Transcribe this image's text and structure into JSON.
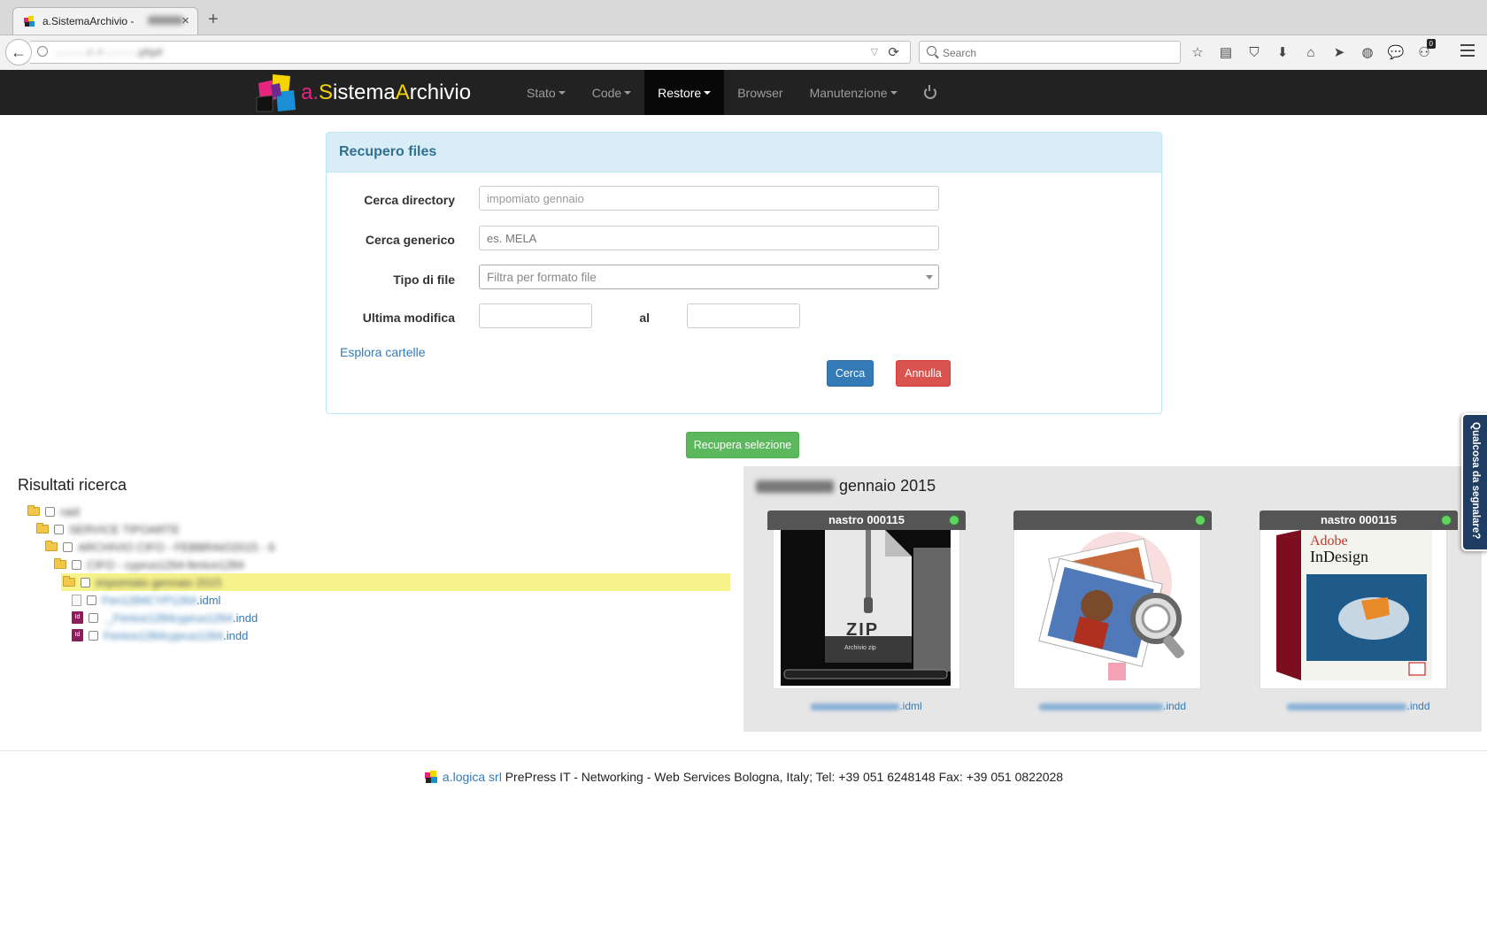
{
  "browser": {
    "tab_title": "a.SistemaArchivio -",
    "tab_close": "×",
    "new_tab": "+",
    "address": "·.··.··.··/··/··.·······.php#",
    "search_placeholder": "Search",
    "addon_badge": "0"
  },
  "app": {
    "brand_a": "a.",
    "brand_s": "S",
    "brand_istema": "istema",
    "brand_A": "A",
    "brand_rchivio": "rchivio",
    "menu": [
      {
        "label": "Stato"
      },
      {
        "label": "Code"
      },
      {
        "label": "Restore"
      },
      {
        "label": "Browser"
      },
      {
        "label": "Manutenzione"
      }
    ]
  },
  "search_panel": {
    "title": "Recupero files",
    "label_directory": "Cerca directory",
    "directory_value": "impomiato gennaio",
    "label_generic": "Cerca generico",
    "generic_placeholder": "es. MELA",
    "label_type": "Tipo di file",
    "type_placeholder": "Filtra per formato file",
    "label_modified": "Ultima modifica",
    "label_to": "al",
    "explore_link": "Esplora cartelle",
    "btn_search": "Cerca",
    "btn_cancel": "Annulla"
  },
  "recover_button": "Recupera selezione",
  "results": {
    "title": "Risultati ricerca",
    "rows": [
      {
        "text": "raid",
        "level": 0
      },
      {
        "text": "SERVICE TIPOARTE",
        "level": 1
      },
      {
        "text": "ARCHIVIO CIFO - FEBBRAIO2015 - 6",
        "level": 2
      },
      {
        "text": "CIFO - cyprus1264-fenice1284",
        "level": 3
      },
      {
        "text": "impomiato gennaio 2015",
        "level": 4
      },
      {
        "blur": "Fen1284CYP1264",
        "ext": ".idml"
      },
      {
        "blur": "._Fenice1284cyprus1264",
        "ext": ".indd"
      },
      {
        "blur": "Fenice1284cyprus1264",
        "ext": ".indd"
      }
    ]
  },
  "preview": {
    "title": "gennaio 2015",
    "cards": [
      {
        "tape": "nastro 000115",
        "ext": ".idml",
        "zip_label": "ZIP",
        "zip_sub": "Archivio zip"
      },
      {
        "tape": "",
        "ext": ".indd"
      },
      {
        "tape": "nastro 000115",
        "ext": ".indd",
        "brand": "Adobe",
        "product": "InDesign"
      }
    ]
  },
  "side_tab": "Qualcosa da segnalare?",
  "footer": {
    "company": "a.logica srl",
    "text": " PrePress IT - Networking - Web Services Bologna, Italy; Tel: +39 051 6248148 Fax: +39 051 0822028"
  }
}
